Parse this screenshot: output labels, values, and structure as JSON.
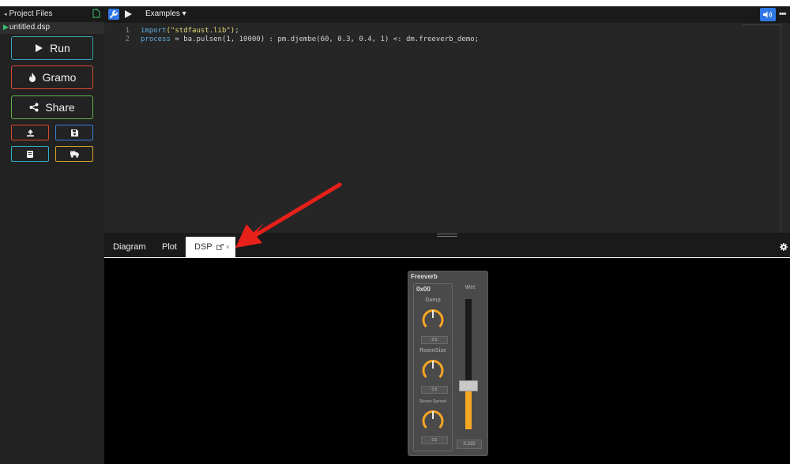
{
  "sidebar": {
    "project_files_label": "Project Files",
    "file_name": "untitled.dsp",
    "run_label": "Run",
    "gramo_label": "Gramo",
    "share_label": "Share",
    "icons": [
      "upload-icon",
      "save-icon",
      "book-icon",
      "truck-icon"
    ]
  },
  "toolbar": {
    "examples_label": "Examples ▾"
  },
  "editor": {
    "line_numbers": [
      "1",
      "2"
    ],
    "line1": {
      "kw": "import",
      "str": "(\"stdfaust.lib\")",
      "rest": ";"
    },
    "line2": {
      "kw": "process",
      "rest": " = ba.pulsen(1, 10000) : pm.djembe(60, 0.3, 0.4, 1) <: dm.freeverb_demo;"
    }
  },
  "panel": {
    "tabs": [
      "Diagram",
      "Plot",
      "DSP"
    ],
    "active_tab": "DSP",
    "close_glyph": "×"
  },
  "freeverb": {
    "title": "Freeverb",
    "group_title": "0x00",
    "knobs": [
      {
        "label": "Damp",
        "value": "0.5"
      },
      {
        "label": "RoomSize",
        "value": "0.5"
      },
      {
        "label": "Stereo Spread",
        "value": "0.5"
      }
    ],
    "wet": {
      "label": "Wet",
      "value": "0.333",
      "level": 0.333
    }
  },
  "colors": {
    "accent": "#2f77e6",
    "run_border": "#3aa2b7",
    "gramo_border": "#d84b31",
    "share_border": "#64b14a",
    "knob_orange": "#f5a623",
    "arrow_red": "#e8201a"
  }
}
